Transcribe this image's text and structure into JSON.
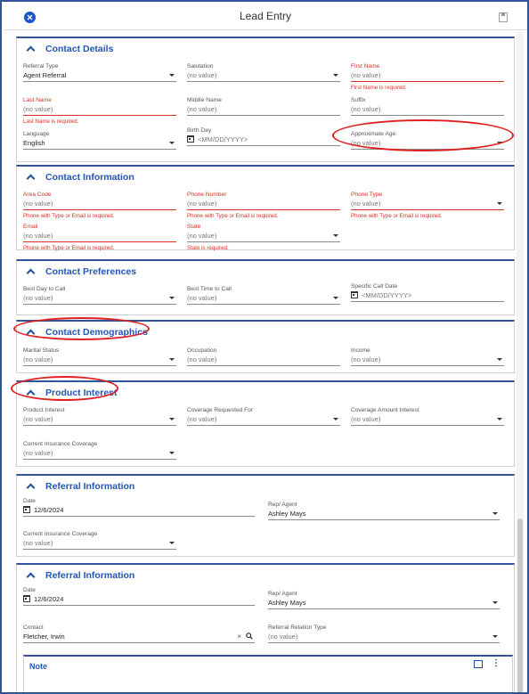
{
  "window": {
    "title": "Lead Entry",
    "close_icon": "close-circle-icon",
    "save_icon": "save-icon"
  },
  "sections": {
    "contact_details": {
      "title": "Contact Details",
      "referral_type": {
        "label": "Referral Type",
        "value": "Agent Referral"
      },
      "salutation": {
        "label": "Salutation",
        "value": "(no value)"
      },
      "first_name": {
        "label": "First Name",
        "value": "(no value)",
        "error": "First Name is required."
      },
      "last_name": {
        "label": "Last Name",
        "value": "(no value)",
        "error": "Last Name is required."
      },
      "middle_name": {
        "label": "Middle Name",
        "value": "(no value)"
      },
      "suffix": {
        "label": "Suffix",
        "value": "(no value)"
      },
      "language": {
        "label": "Language",
        "value": "English"
      },
      "birth_day": {
        "label": "Birth Day",
        "placeholder": "<MM/DD/YYYY>"
      },
      "approx_age": {
        "label": "Approximate Age",
        "value": "(no value)"
      }
    },
    "contact_information": {
      "title": "Contact Information",
      "area_code": {
        "label": "Area Code",
        "value": "(no value)",
        "error": "Phone with Type or Email is required."
      },
      "phone_number": {
        "label": "Phone Number",
        "value": "(no value)",
        "error": "Phone with Type or Email is required."
      },
      "phone_type": {
        "label": "Phone Type",
        "value": "(no value)",
        "error": "Phone with Type or Email is required."
      },
      "email": {
        "label": "Email",
        "value": "(no value)",
        "error": "Phone with Type or Email is required."
      },
      "state": {
        "label": "State",
        "value": "(no value)",
        "error": "State is required."
      }
    },
    "contact_preferences": {
      "title": "Contact Preferences",
      "best_day": {
        "label": "Best Day to Call",
        "value": "(no value)"
      },
      "best_time": {
        "label": "Best Time to Call",
        "value": "(no value)"
      },
      "specific_date": {
        "label": "Specific Call Date",
        "placeholder": "<MM/DD/YYYY>"
      }
    },
    "contact_demographics": {
      "title": "Contact Demographics",
      "marital_status": {
        "label": "Marital Status",
        "value": "(no value)"
      },
      "occupation": {
        "label": "Occupation",
        "value": "(no value)"
      },
      "income": {
        "label": "Income",
        "value": "(no value)"
      }
    },
    "product_interest": {
      "title": "Product Interest",
      "product_interest": {
        "label": "Product Interest",
        "value": "(no value)"
      },
      "coverage_for": {
        "label": "Coverage Requested For",
        "value": "(no value)"
      },
      "coverage_amount": {
        "label": "Coverage Amount Interest",
        "value": "(no value)"
      },
      "current_coverage": {
        "label": "Current Insurance Coverage",
        "value": "(no value)"
      }
    },
    "referral_information_1": {
      "title": "Referral Information",
      "date": {
        "label": "Date",
        "value": "12/6/2024"
      },
      "rep_agent": {
        "label": "Rep/ Agent",
        "value": "Ashley Mays"
      },
      "current_coverage": {
        "label": "Current Insurance Coverage",
        "value": "(no value)"
      }
    },
    "referral_information_2": {
      "title": "Referral Information",
      "date": {
        "label": "Date",
        "value": "12/6/2024"
      },
      "rep_agent": {
        "label": "Rep/ Agent",
        "value": "Ashley Mays"
      },
      "contact": {
        "label": "Contact",
        "value": "Fletcher, Irwin"
      },
      "relation_type": {
        "label": "Referral Relation Type",
        "value": "(no value)"
      }
    },
    "note": {
      "title": "Note"
    }
  },
  "glyphs": {
    "clear": "×",
    "kebab": "⋮"
  },
  "colors": {
    "accent": "#2355b5",
    "section_border": "#2f5597",
    "error": "#d93025",
    "annotation_oval": "#e02020"
  }
}
